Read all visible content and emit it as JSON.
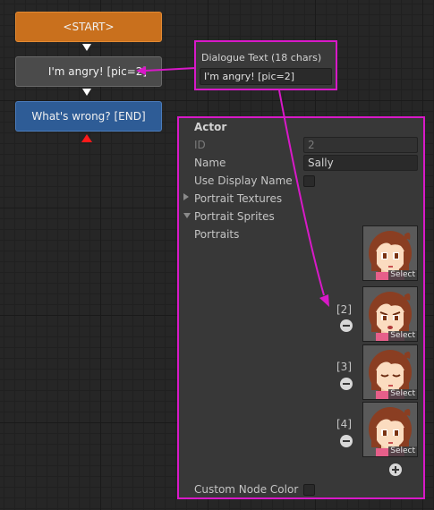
{
  "graph": {
    "nodes": [
      {
        "label": "<START>"
      },
      {
        "label": "I'm angry! [pic=2]"
      },
      {
        "label": "What's wrong? [END]"
      }
    ]
  },
  "dialogue_popup": {
    "title": "Dialogue Text (18 chars)",
    "value": "I'm angry! [pic=2]"
  },
  "inspector": {
    "section_title": "Actor",
    "id_label": "ID",
    "id_value": "2",
    "name_label": "Name",
    "name_value": "Sally",
    "use_display_name_label": "Use Display Name",
    "portrait_textures_label": "Portrait Textures",
    "portrait_sprites_label": "Portrait Sprites",
    "portraits_label": "Portraits",
    "select_label": "Select",
    "portraits": [
      {
        "index": "",
        "expression": "neutral"
      },
      {
        "index": "[2]",
        "expression": "angry"
      },
      {
        "index": "[3]",
        "expression": "eyes-closed"
      },
      {
        "index": "[4]",
        "expression": "neutral"
      }
    ],
    "custom_node_color_label": "Custom Node Color"
  },
  "colors": {
    "start_node": "#c9701d",
    "dialogue_node": "#4b4b4b",
    "end_node": "#2e5c96",
    "highlight": "#d819c8"
  }
}
